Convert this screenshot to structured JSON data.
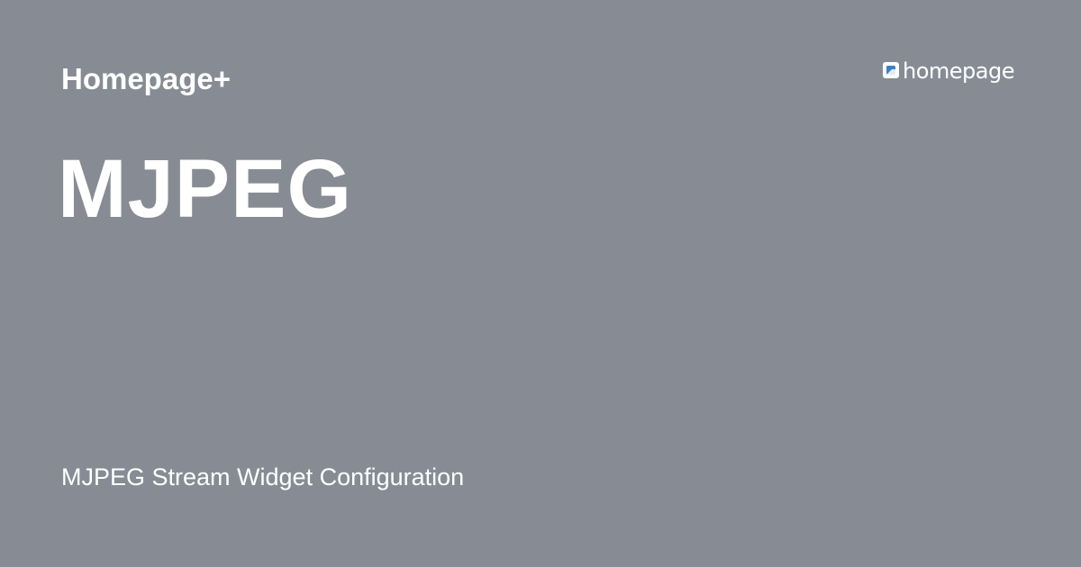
{
  "header": {
    "site_name": "Homepage+"
  },
  "logo": {
    "text": "homepage",
    "icon": "homepage-logo-icon",
    "accent_color": "#3b82c4"
  },
  "main": {
    "title": "MJPEG",
    "description": "MJPEG Stream Widget Configuration"
  },
  "colors": {
    "background": "#878c94",
    "text": "#ffffff"
  }
}
